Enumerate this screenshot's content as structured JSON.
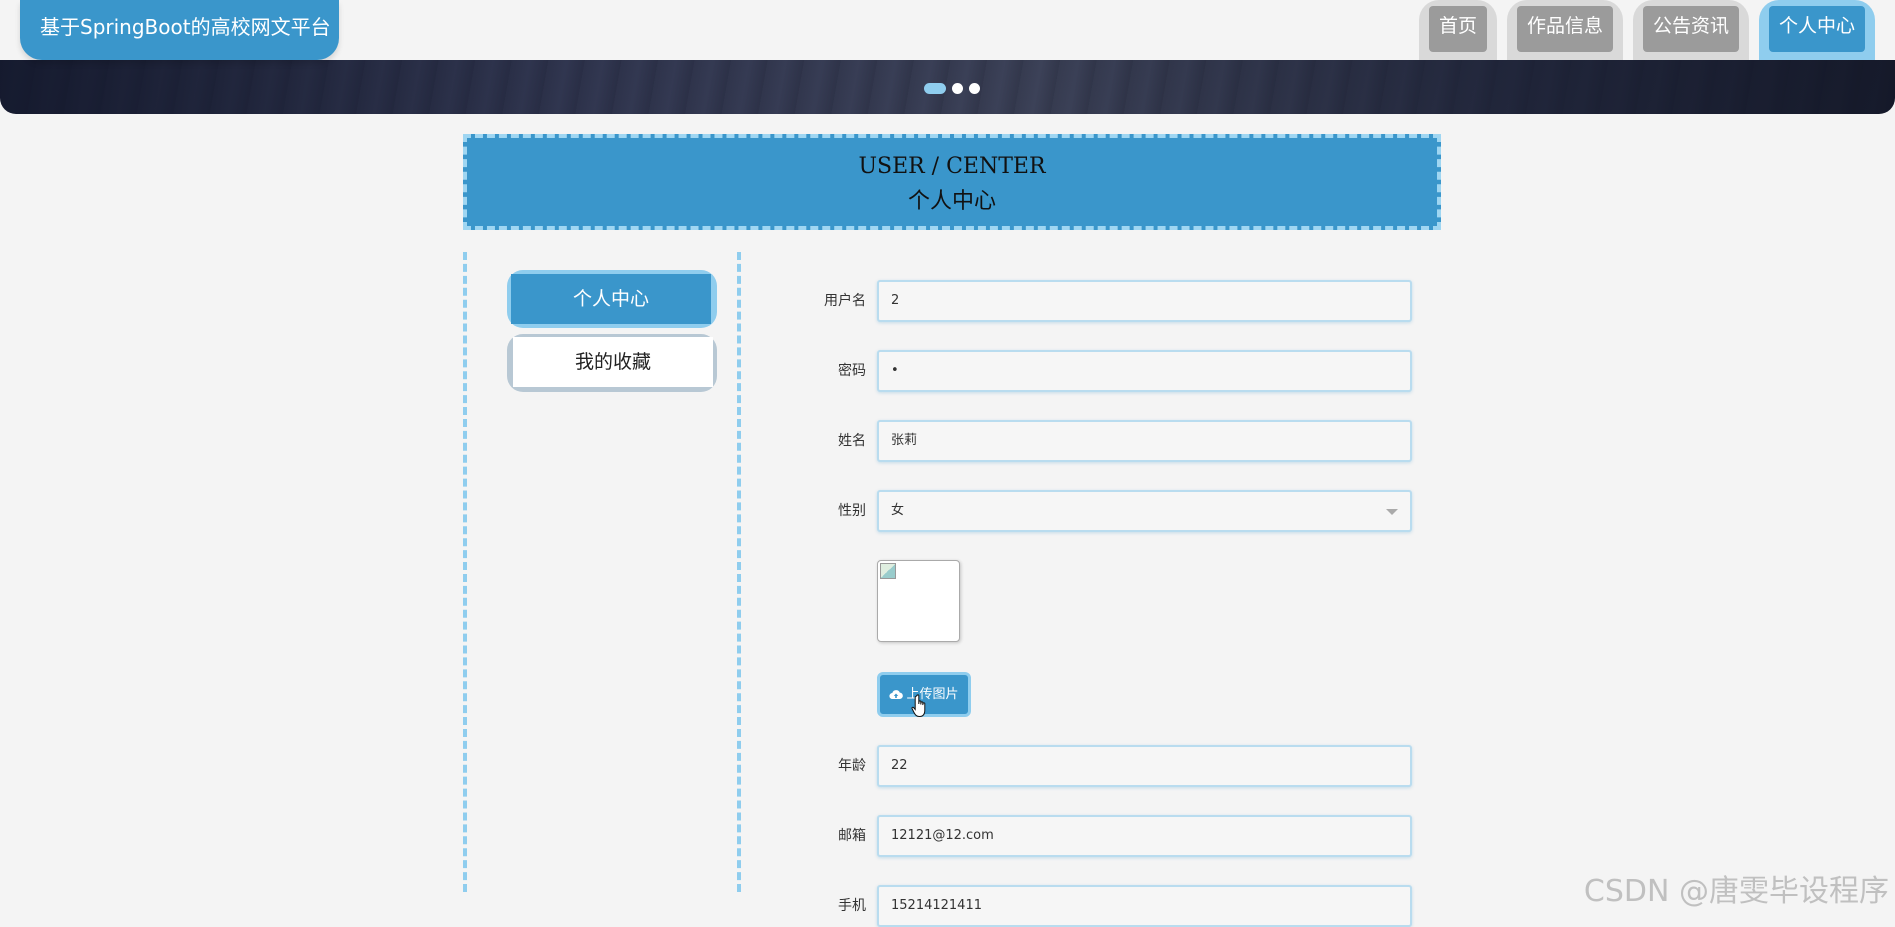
{
  "header": {
    "site_title": "基于SpringBoot的高校网文平台",
    "nav": [
      {
        "label": "首页",
        "active": false
      },
      {
        "label": "作品信息",
        "active": false
      },
      {
        "label": "公告资讯",
        "active": false
      },
      {
        "label": "个人中心",
        "active": true
      }
    ]
  },
  "banner": {
    "slide_count": 3,
    "active_slide": 1
  },
  "section": {
    "title_en": "USER / CENTER",
    "title_zh": "个人中心"
  },
  "sidebar": {
    "items": [
      {
        "label": "个人中心",
        "active": true
      },
      {
        "label": "我的收藏",
        "active": false
      }
    ]
  },
  "form": {
    "username": {
      "label": "用户名",
      "value": "2"
    },
    "password": {
      "label": "密码",
      "value": "•"
    },
    "name": {
      "label": "姓名",
      "value": "张莉"
    },
    "gender": {
      "label": "性别",
      "value": "女"
    },
    "upload_button": "上传图片",
    "age": {
      "label": "年龄",
      "value": "22"
    },
    "email": {
      "label": "邮箱",
      "value": "12121@12.com"
    },
    "phone": {
      "label": "手机",
      "value": "15214121411"
    }
  },
  "watermark": "CSDN @唐雯毕设程序",
  "colors": {
    "accent": "#3a96cb",
    "accent_light": "#8fcdee",
    "nav_inactive": "#9b9b9b",
    "background": "#f4f4f4"
  }
}
